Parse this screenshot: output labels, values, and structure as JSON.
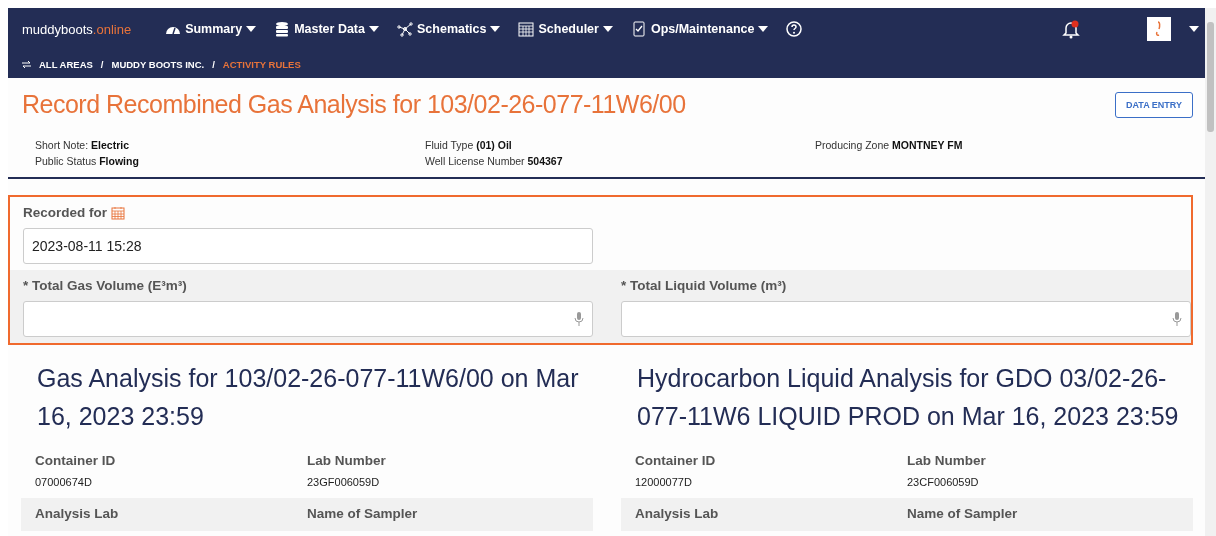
{
  "brand": {
    "name": "muddyboots",
    "suffix": ".online"
  },
  "nav": [
    {
      "label": "Summary",
      "has_menu": true
    },
    {
      "label": "Master Data",
      "has_menu": true
    },
    {
      "label": "Schematics",
      "has_menu": true
    },
    {
      "label": "Scheduler",
      "has_menu": true
    },
    {
      "label": "Ops/Maintenance",
      "has_menu": true
    }
  ],
  "notifications": {
    "unread": true
  },
  "breadcrumb": [
    {
      "label": "ALL AREAS",
      "current": false
    },
    {
      "separator": "/",
      "label": "MUDDY BOOTS INC.",
      "current": false
    },
    {
      "separator": "/",
      "label": "ACTIVITY RULES",
      "current": true
    }
  ],
  "page_title": "Record Recombined Gas Analysis for 103/02-26-077-11W6/00",
  "mode_button": "DATA ENTRY",
  "info_columns": [
    [
      "Short Note: **Electric**",
      "Public Status **Flowing**"
    ],
    [
      "Fluid Type **(01) Oil**",
      "Well License Number **504367**"
    ],
    [
      "Producing Zone **MONTNEY FM**"
    ]
  ],
  "form_rows": [
    {
      "fields": [
        {
          "kind": "date",
          "label": "Recorded for",
          "value": "2023-08-11 15:28"
        }
      ]
    },
    {
      "fields": [
        {
          "kind": "voice",
          "label": "* Total Gas Volume (E³m³)"
        },
        {
          "kind": "voice",
          "label": "* Total Liquid Volume (m³)"
        }
      ]
    }
  ],
  "analyses": [
    {
      "title": "Gas Analysis for 103/02-26-077-11W6/00 on Mar 16, 2023 23:59",
      "rows": [
        [
          {
            "label": "Container ID",
            "value": "07000674D"
          },
          {
            "label": "Lab Number",
            "value": "23GF006059D"
          }
        ],
        [
          {
            "label": "Analysis Lab"
          },
          {
            "label": "Name of Sampler"
          }
        ]
      ]
    },
    {
      "title": "Hydrocarbon Liquid Analysis for GDO 03/02-26-077-11W6 LIQUID PROD on Mar 16, 2023 23:59",
      "rows": [
        [
          {
            "label": "Container ID",
            "value": "12000077D"
          },
          {
            "label": "Lab Number",
            "value": "23CF006059D"
          }
        ],
        [
          {
            "label": "Analysis Lab"
          },
          {
            "label": "Name of Sampler"
          }
        ]
      ]
    }
  ]
}
